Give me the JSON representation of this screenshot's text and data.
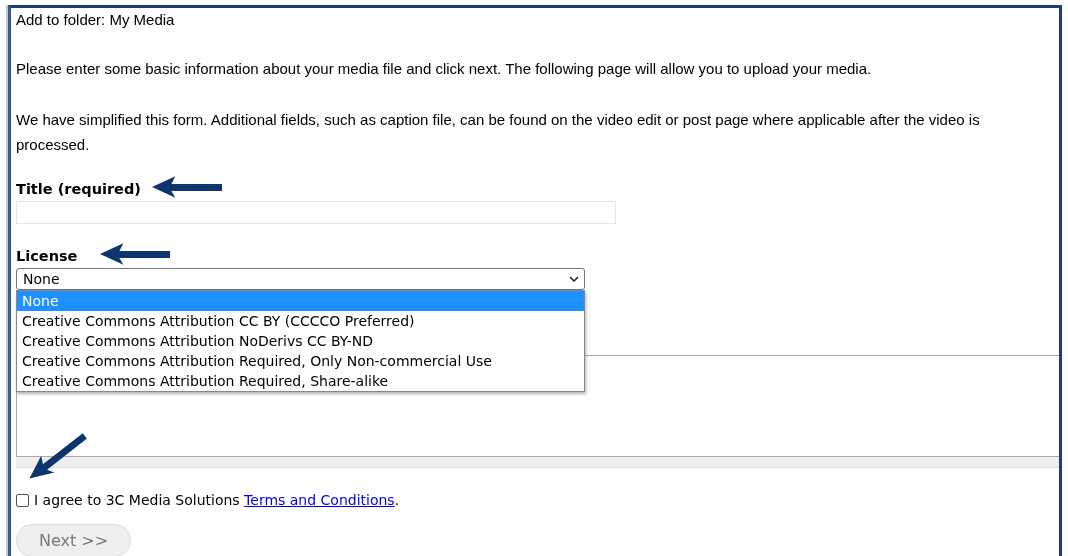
{
  "header": {
    "folder_line": "Add to folder: My Media"
  },
  "intro": [
    "Please enter some basic information about your media file and click next. The following page will allow you to upload your media.",
    "We have simplified this form. Additional fields, such as caption file, can be found on the video edit or post page where applicable after the video is processed."
  ],
  "title_field": {
    "label": "Title (required)"
  },
  "license": {
    "label": "License",
    "value": "None",
    "expanded": true,
    "options": [
      {
        "label": "None",
        "selected": true
      },
      {
        "label": "Creative Commons Attribution CC BY (CCCCO Preferred)",
        "selected": false
      },
      {
        "label": "Creative Commons Attribution NoDerivs CC BY-ND",
        "selected": false
      },
      {
        "label": "Creative Commons Attribution Required, Only Non-commercial Use",
        "selected": false
      },
      {
        "label": "Creative Commons Attribution Required, Share-alike",
        "selected": false
      }
    ]
  },
  "agreement": {
    "checked": false,
    "text": "I agree to 3C Media Solutions",
    "link": "Terms and Conditions",
    "end": "."
  },
  "next_button": {
    "label": "Next >>",
    "disabled": true
  }
}
